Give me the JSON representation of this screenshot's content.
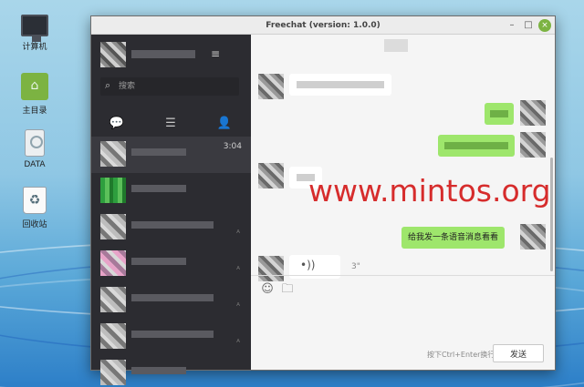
{
  "window": {
    "title": "Freechat (version: 1.0.0)",
    "buttons": {
      "minimize": "–",
      "maximize": "□",
      "close": "×"
    }
  },
  "desktop": {
    "icons": [
      {
        "label": "计算机",
        "icon": "computer-icon"
      },
      {
        "label": "主目录",
        "icon": "home-folder-icon"
      },
      {
        "label": "DATA",
        "icon": "drive-icon"
      },
      {
        "label": "回收站",
        "icon": "trash-icon"
      }
    ]
  },
  "sidebar": {
    "menu_icon": "≡",
    "search": {
      "placeholder": "搜索"
    },
    "tabs": [
      {
        "name": "chats",
        "icon": "chat-bubble-icon",
        "glyph": "💬",
        "active": true
      },
      {
        "name": "contacts-list",
        "icon": "list-icon",
        "glyph": "☰",
        "active": false
      },
      {
        "name": "friends",
        "icon": "person-icon",
        "glyph": "👤",
        "active": false
      }
    ],
    "chats": [
      {
        "time": "3:04",
        "muted": false,
        "active": true
      },
      {
        "time": "",
        "muted": false,
        "active": false
      },
      {
        "time": "",
        "muted": true,
        "active": false
      },
      {
        "time": "",
        "muted": true,
        "active": false
      },
      {
        "time": "",
        "muted": true,
        "active": false
      },
      {
        "time": "",
        "muted": true,
        "active": false
      },
      {
        "time": "",
        "muted": false,
        "active": false
      }
    ]
  },
  "conversation": {
    "outgoing_text": "给我发一条语音消息看看",
    "voice_duration": "3\"",
    "voice_icon": "•))"
  },
  "composer": {
    "hint": "按下Ctrl+Enter换行",
    "send_label": "发送",
    "emoji_icon": "☺",
    "file_icon": "🗀"
  },
  "watermark": "www.mintos.org"
}
